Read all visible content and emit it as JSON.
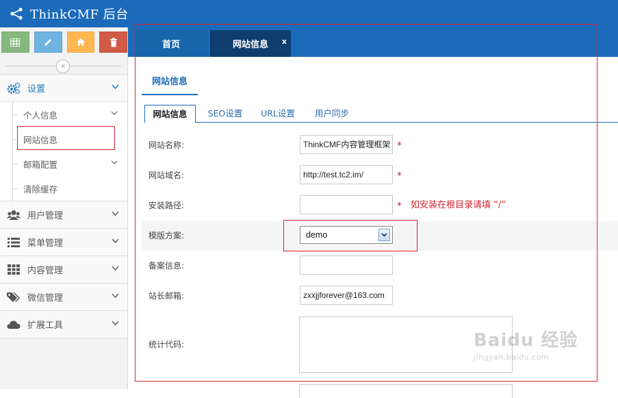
{
  "app": {
    "title": "ThinkCMF 后台"
  },
  "colors": {
    "primary": "#1c6bba",
    "active_tab": "#0d3e6e",
    "annotation_red": "#d9232d"
  },
  "shortcuts": [
    {
      "name": "grid-icon",
      "color": "#87b87f"
    },
    {
      "name": "pencil-icon",
      "color": "#6fb3e0"
    },
    {
      "name": "home-icon",
      "color": "#ffb752"
    },
    {
      "name": "trash-icon",
      "color": "#d15b47"
    }
  ],
  "sidebar": {
    "collapse_glyph": "«",
    "settings": {
      "label": "设置",
      "children": [
        {
          "label": "个人信息"
        },
        {
          "label": "网站信息"
        },
        {
          "label": "邮箱配置"
        },
        {
          "label": "清除缓存"
        }
      ]
    },
    "items": [
      {
        "label": "用户管理",
        "icon": "users-icon"
      },
      {
        "label": "菜单管理",
        "icon": "list-icon"
      },
      {
        "label": "内容管理",
        "icon": "th-icon"
      },
      {
        "label": "微信管理",
        "icon": "tags-icon"
      },
      {
        "label": "扩展工具",
        "icon": "cloud-icon"
      }
    ]
  },
  "tabs": [
    {
      "label": "首页"
    },
    {
      "label": "网站信息",
      "close": "x"
    }
  ],
  "page": {
    "title": "网站信息",
    "subtabs": [
      "网站信息",
      "SEO设置",
      "URL设置",
      "用户同步"
    ]
  },
  "form": {
    "site_name": {
      "label": "网站名称:",
      "value": "ThinkCMF内容管理框架",
      "required": "*"
    },
    "site_domain": {
      "label": "网站域名:",
      "value": "http://test.tc2.im/",
      "required": "*"
    },
    "install_path": {
      "label": "安装路径:",
      "value": "",
      "required": "*",
      "hint": "如安装在根目录请填 “/”"
    },
    "template": {
      "label": "模版方案:",
      "value": "demo"
    },
    "icp": {
      "label": "备案信息:",
      "value": ""
    },
    "admin_email": {
      "label": "站长邮箱:",
      "value": "zxxjjforever@163.com"
    },
    "stats_code": {
      "label": "统计代码:",
      "value": ""
    }
  },
  "watermark": {
    "line1": "Baidu 经验",
    "line2": "jingyan.baidu.com"
  }
}
